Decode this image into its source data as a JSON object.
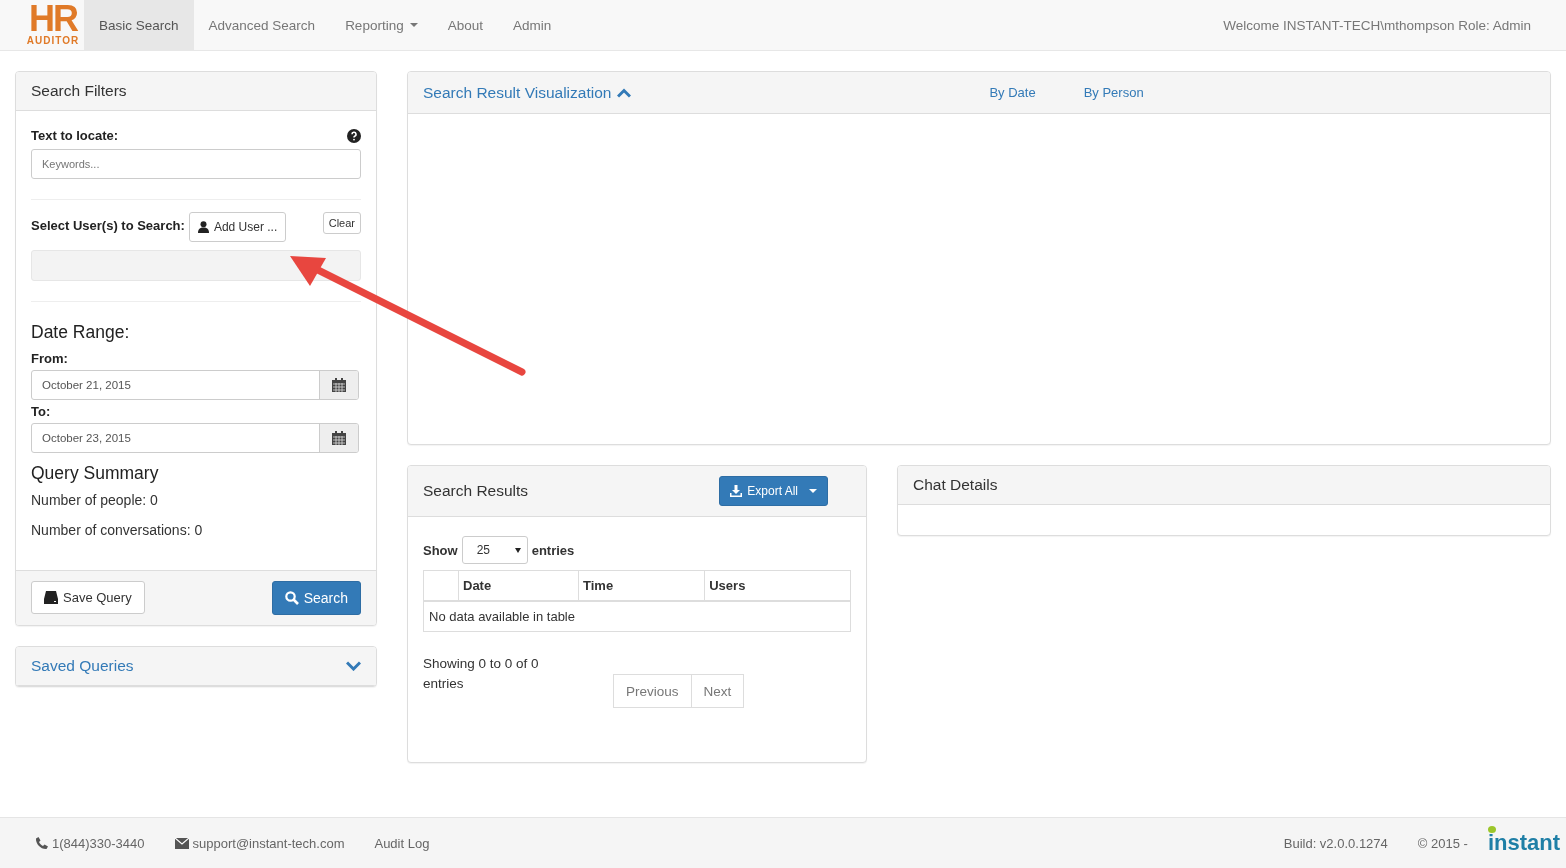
{
  "navbar": {
    "logo": {
      "main": "HR",
      "sub": "AUDITOR"
    },
    "items": [
      {
        "label": "Basic Search",
        "selected": true,
        "dropdown": false
      },
      {
        "label": "Advanced Search",
        "selected": false,
        "dropdown": false
      },
      {
        "label": "Reporting",
        "selected": false,
        "dropdown": true
      },
      {
        "label": "About",
        "selected": false,
        "dropdown": false
      },
      {
        "label": "Admin",
        "selected": false,
        "dropdown": false
      }
    ],
    "welcome": "Welcome INSTANT-TECH\\mthompson Role: Admin"
  },
  "filters": {
    "title": "Search Filters",
    "text_label": "Text to locate:",
    "keywords": {
      "placeholder": "Keywords..."
    },
    "users_label": "Select User(s) to Search:",
    "add_user": "Add User ...",
    "clear": "Clear",
    "date_range_title": "Date Range:",
    "from_label": "From:",
    "from_value": "October 21, 2015",
    "to_label": "To:",
    "to_value": "October 23, 2015",
    "summary_title": "Query Summary",
    "summary": [
      "Number of people: 0",
      "Number of conversations: 0"
    ],
    "save_button": "Save Query",
    "search_button": "Search"
  },
  "saved_queries": {
    "title": "Saved Queries",
    "expanded": false
  },
  "visualization": {
    "title": "Search Result Visualization",
    "expanded": true,
    "tabs": [
      "By Date",
      "By Person"
    ]
  },
  "results": {
    "title": "Search Results",
    "export": "Export All",
    "show_label": "Show",
    "page_size": "25",
    "entries_label": "entries",
    "columns": [
      "Date",
      "Time",
      "Users"
    ],
    "empty_message": "No data available in table",
    "info": "Showing 0 to 0 of 0 entries",
    "pager": [
      {
        "label": "Previous",
        "disabled": true
      },
      {
        "label": "Next",
        "disabled": true
      }
    ]
  },
  "chat_details": {
    "title": "Chat Details"
  },
  "footer": {
    "phone": "1(844)330-3440",
    "email": "support@instant-tech.com",
    "audit_log": "Audit Log",
    "build": "Build: v2.0.0.1274",
    "copyright": "© 2015 -",
    "brand": "instant"
  }
}
